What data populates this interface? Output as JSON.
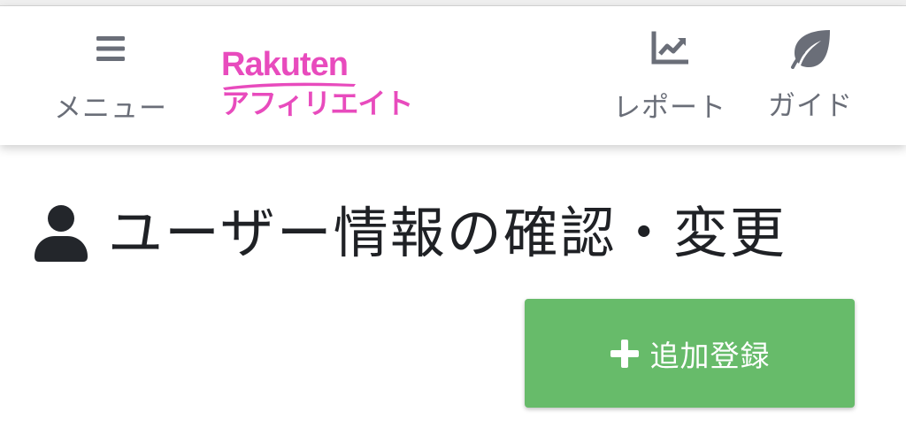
{
  "header": {
    "menu_label": "メニュー",
    "logo": {
      "brand": "Rakuten",
      "sub": "アフィリエイト"
    },
    "report_label": "レポート",
    "guide_label": "ガイド",
    "icons": {
      "menu": "hamburger-icon",
      "report": "chart-icon",
      "guide": "leaf-icon"
    }
  },
  "main": {
    "title": "ユーザー情報の確認・変更",
    "title_icon": "user-icon",
    "add_button": {
      "label": "追加登録",
      "icon": "plus-icon"
    }
  },
  "colors": {
    "brand_pink": "#e84bbd",
    "nav_gray": "#6a6e78",
    "button_green": "#67bb6a",
    "title_text": "#1f2125"
  }
}
